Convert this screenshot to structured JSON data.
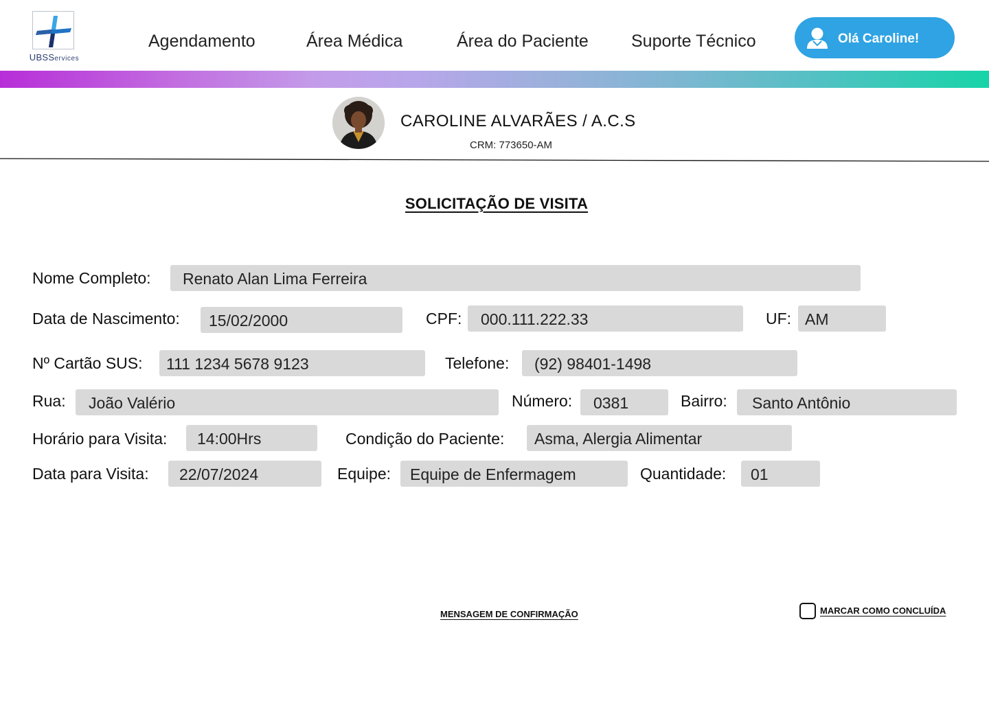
{
  "brand": {
    "logo_text_main": "UBS",
    "logo_text_sub": "ervices",
    "logo_text_s": "S"
  },
  "nav": [
    {
      "label": "Agendamento"
    },
    {
      "label": "Área Médica"
    },
    {
      "label": "Área do Paciente"
    },
    {
      "label": "Suporte Técnico"
    }
  ],
  "user_button": {
    "label": "Olá Caroline!",
    "icon": "user-icon"
  },
  "profile": {
    "name": "CAROLINE ALVARÃES / A.C.S",
    "crm": "CRM: 773650-AM"
  },
  "page_title": "SOLICITAÇÃO DE VISITA",
  "form": {
    "nome_completo": {
      "label": "Nome Completo:",
      "value": "Renato Alan Lima Ferreira"
    },
    "data_nascimento": {
      "label": "Data de Nascimento:",
      "value": "15/02/2000"
    },
    "cpf": {
      "label": "CPF:",
      "value": "000.111.222.33"
    },
    "uf": {
      "label": "UF:",
      "value": "AM"
    },
    "cartao_sus": {
      "label": "Nº Cartão SUS:",
      "value": "111 1234 5678 9123"
    },
    "telefone": {
      "label": "Telefone:",
      "value": "(92) 98401-1498"
    },
    "rua": {
      "label": "Rua:",
      "value": "João Valério"
    },
    "numero": {
      "label": "Número:",
      "value": "0381"
    },
    "bairro": {
      "label": "Bairro:",
      "value": "Santo Antônio"
    },
    "horario_visita": {
      "label": "Horário para Visita:",
      "value": "14:00Hrs"
    },
    "condicao_paciente": {
      "label": "Condição do Paciente:",
      "value": "Asma, Alergia Alimentar"
    },
    "data_visita": {
      "label": "Data para Visita:",
      "value": "22/07/2024"
    },
    "equipe": {
      "label": "Equipe:",
      "value": "Equipe de Enfermagem"
    },
    "quantidade": {
      "label": "Quantidade:",
      "value": "01"
    }
  },
  "footer": {
    "confirm_message": "MENSAGEM DE CONFIRMAÇÃO",
    "mark_done": "MARCAR COMO CONCLUÍDA"
  },
  "colors": {
    "accent": "#2fa3e3",
    "field_bg": "#d9d9d9",
    "gradient_start": "#b72ed8",
    "gradient_end": "#17d4a8"
  }
}
